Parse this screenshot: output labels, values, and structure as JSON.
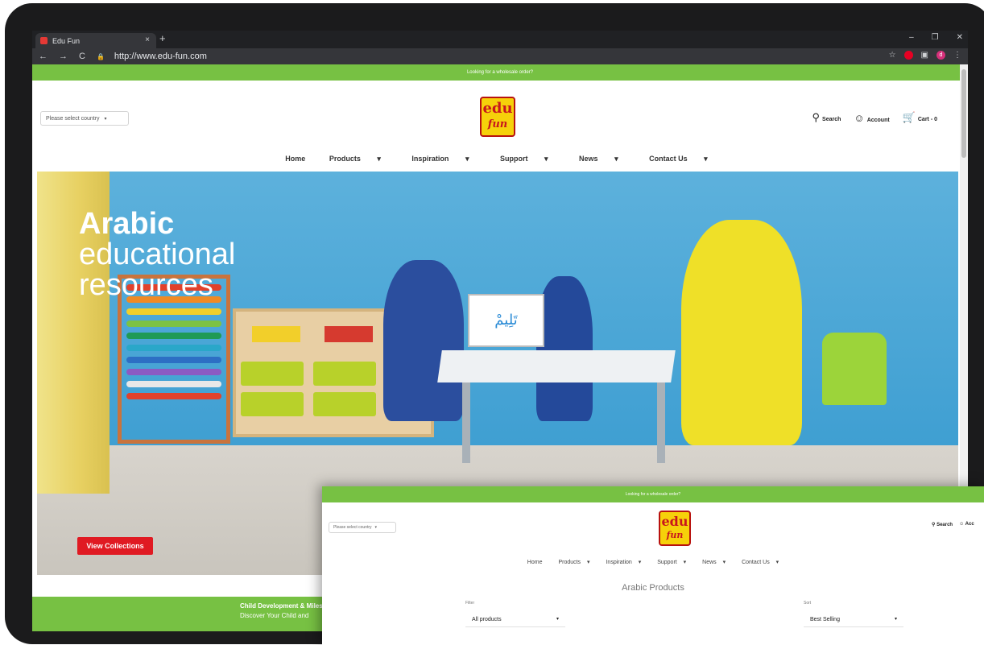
{
  "browser": {
    "tab_title": "Edu Fun",
    "tab_close": "×",
    "new_tab": "+",
    "url": "http://www.edu-fun.com",
    "window_controls": [
      "–",
      "❐",
      "✕"
    ],
    "nav_icons": [
      "←",
      "→",
      "C",
      "🔒"
    ],
    "avatar_letter": "d"
  },
  "site": {
    "promo": "Looking for a wholesale order?",
    "country_select": "Please select country",
    "logo_top": "edu",
    "logo_bottom": "fun",
    "header": {
      "search": "Search",
      "account": "Account",
      "cart": "Cart - 0"
    },
    "nav": [
      "Home",
      "Products",
      "Inspiration",
      "Support",
      "News",
      "Contact Us"
    ],
    "hero": {
      "line1": "Arabic",
      "line2": "educational",
      "line3": "resources",
      "card_word": "تَلِيمْ",
      "button": "View Collections"
    },
    "strip": {
      "line1": "Child Development & Milesto",
      "line2": "Discover Your Child and"
    }
  },
  "overlay": {
    "promo": "Looking for a wholesale order?",
    "country_select": "Please select country",
    "logo_top": "edu",
    "logo_bottom": "fun",
    "header": {
      "search": "Search",
      "account": "Acc"
    },
    "nav": [
      "Home",
      "Products",
      "Inspiration",
      "Support",
      "News",
      "Contact Us"
    ],
    "title": "Arabic Products",
    "filter_label": "Filter",
    "filter_value": "All products",
    "sort_label": "Sort",
    "sort_value": "Best Selling"
  },
  "colors": {
    "green": "#77c143",
    "red": "#e01a22",
    "logo_yellow": "#f6d10a",
    "logo_red": "#c8161d"
  }
}
